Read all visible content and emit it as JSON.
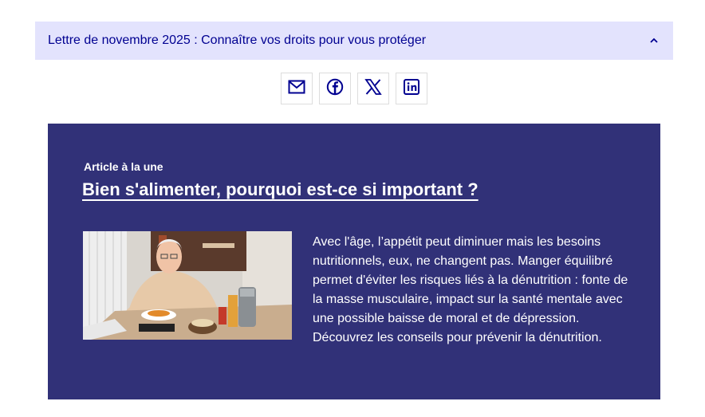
{
  "accordion": {
    "title": "Lettre de novembre 2025 : Connaître vos droits pour vous protéger",
    "chevron_icon": "chevron-up-icon"
  },
  "share": [
    {
      "name": "share-email-button",
      "icon": "mail-icon"
    },
    {
      "name": "share-facebook-button",
      "icon": "facebook-icon"
    },
    {
      "name": "share-x-button",
      "icon": "x-icon"
    },
    {
      "name": "share-linkedin-button",
      "icon": "linkedin-icon"
    }
  ],
  "feature": {
    "kicker": "Article à la une",
    "headline": "Bien s'alimenter, pourquoi est-ce si important ?",
    "body": "Avec l'âge, l’appétit peut diminuer mais les besoins nutritionnels, eux, ne changent pas. Manger équilibré permet d'éviter les risques liés à la dénutrition : fonte de la masse musculaire, impact sur la santé mentale avec une possible baisse de moral et de dépression. Découvrez les conseils pour prévenir la dénutrition."
  },
  "colors": {
    "accordion_bg": "#e3e3fd",
    "accordion_text": "#000091",
    "feature_bg": "#313178",
    "icon_color": "#000091"
  }
}
